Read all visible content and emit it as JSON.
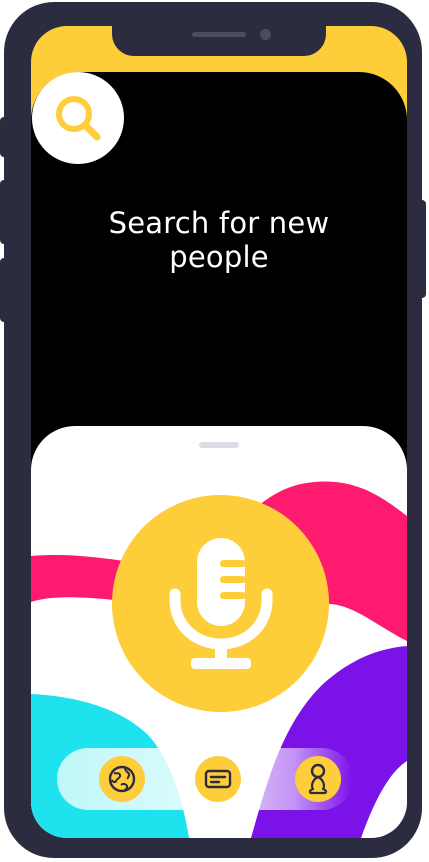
{
  "colors": {
    "frame": "#2c2c40",
    "accent_yellow": "#fecd3a",
    "icon_dark": "#2c2c40",
    "wave_pink": "#fe1a6e",
    "wave_purple": "#7b12e8",
    "wave_cyan": "#1ee3ee",
    "panel_black": "#000000"
  },
  "search": {
    "icon": "search-icon"
  },
  "headline": {
    "line1": "Search for new",
    "line2": "people"
  },
  "mic": {
    "icon": "microphone-icon"
  },
  "nav": {
    "items": [
      {
        "icon": "globe-icon"
      },
      {
        "icon": "chat-icon"
      },
      {
        "icon": "profile-icon"
      }
    ]
  }
}
